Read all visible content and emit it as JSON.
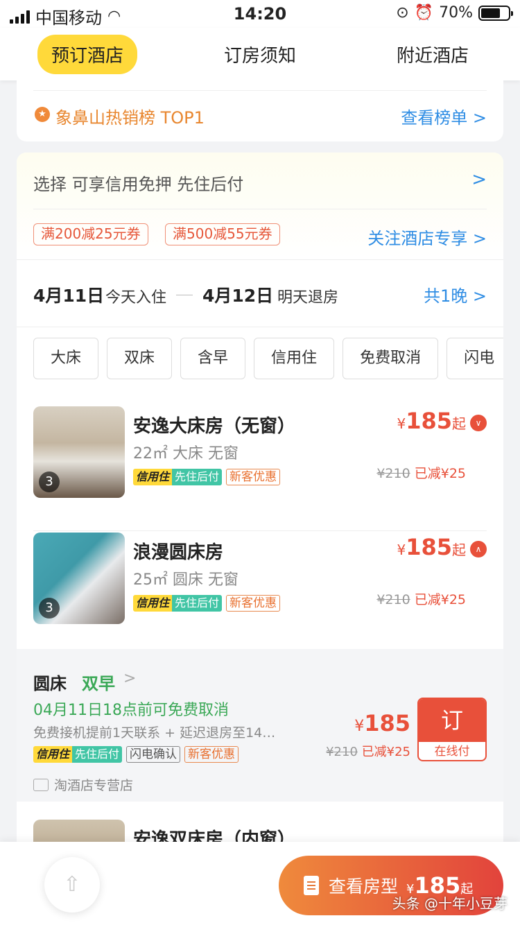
{
  "status": {
    "carrier": "中国移动",
    "time": "14:20",
    "battery": "70%"
  },
  "tabs": [
    "预订酒店",
    "订房须知",
    "附近酒店"
  ],
  "rank": {
    "text": "象鼻山热销榜 TOP1",
    "link": "查看榜单 >"
  },
  "perk": {
    "title": "选择   可享信用免押 先住后付",
    "chevron": ">",
    "coupons": [
      "满200减25元券",
      "满500减55元券"
    ],
    "link": "关注酒店专享 >"
  },
  "dates": {
    "checkin": "4月11日",
    "checkin_sub": "今天入住",
    "checkout": "4月12日",
    "checkout_sub": "明天退房",
    "nights": "共1晚 >"
  },
  "filters": [
    "大床",
    "双床",
    "含早",
    "信用住",
    "免费取消",
    "闪电"
  ],
  "badge": {
    "credit": "信用住",
    "pay_later": "先住后付",
    "new": "新客优惠",
    "flash": "闪电确认"
  },
  "rooms": [
    {
      "name": "安逸大床房（无窗）",
      "info": "22㎡ 大床 无窗",
      "photos": "3",
      "price_sym": "¥",
      "price": "185",
      "price_suffix": "起",
      "orig": "¥210",
      "saved": "已减¥25",
      "toggle": "∨"
    },
    {
      "name": "浪漫圆床房",
      "info": "25㎡ 圆床 无窗",
      "photos": "3",
      "price_sym": "¥",
      "price": "185",
      "price_suffix": "起",
      "orig": "¥210",
      "saved": "已减¥25",
      "toggle": "∧"
    },
    {
      "name": "安逸双床房（内窗）"
    }
  ],
  "plan": {
    "name": "圆床",
    "breakfast": "双早",
    "chevron": ">",
    "cancel": "04月11日18点前可免费取消",
    "desc": "免费接机提前1天联系 + 延迟退房至14…",
    "store": "淘酒店专营店",
    "price_sym": "¥",
    "price": "185",
    "orig": "¥210",
    "saved": "已减¥25",
    "book": "订",
    "book_sub": "在线付"
  },
  "bottom": {
    "view": "查看房型",
    "price_sym": "¥",
    "price": "185",
    "suffix": "起",
    "watermark": "头条 @十年小豆芽"
  },
  "colors": {
    "accent": "#ffd93a",
    "price": "#e8503a",
    "link": "#2f8de4",
    "green": "#3aa856"
  }
}
